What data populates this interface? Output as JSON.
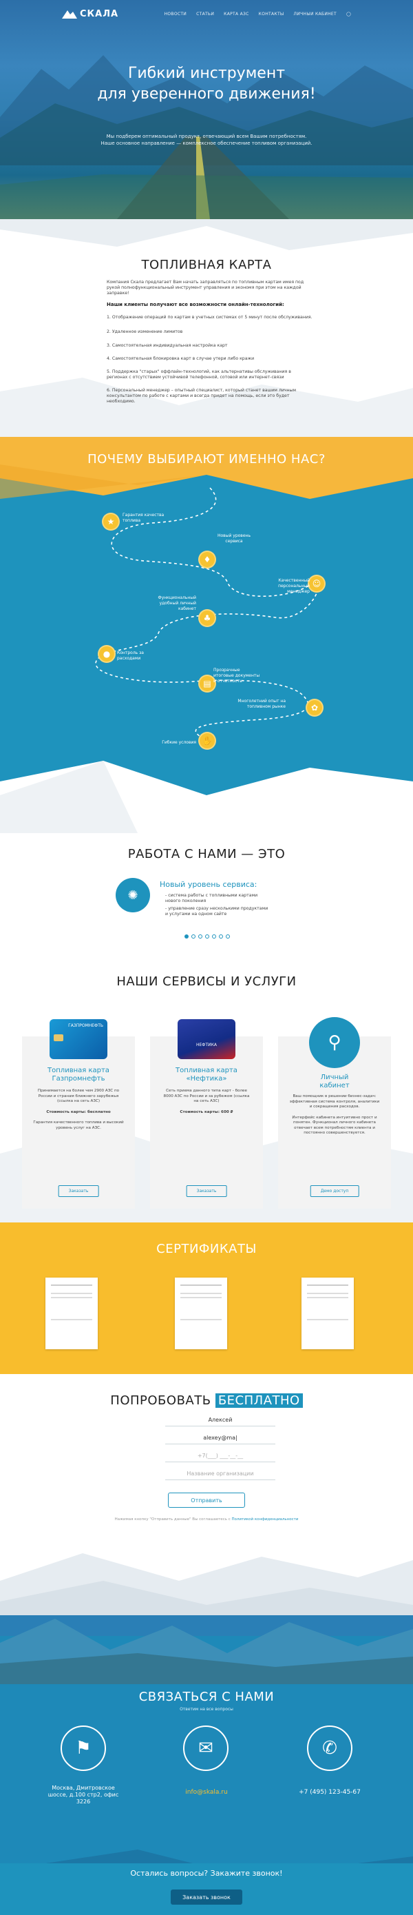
{
  "nav": {
    "logo": "СКАЛА",
    "items": [
      "НОВОСТИ",
      "СТАТЬИ",
      "КАРТА АЗС",
      "КОНТАКТЫ",
      "ЛИЧНЫЙ КАБИНЕТ"
    ]
  },
  "hero": {
    "title_1": "Гибкий инструмент",
    "title_2": "для уверенного движения!",
    "sub_1": "Мы подберем оптимальный продукт, отвечающий всем Вашим потребностям.",
    "sub_2": "Наше основное направление — комплексное обеспечение топливом организаций."
  },
  "fuel": {
    "title": "ТОПЛИВНАЯ КАРТА",
    "intro": "Компания Скала предлагает Вам начать заправляться по топливным картам имея под рукой полнофункциональный инструмент управления и экономя при этом на каждой заправке!",
    "subtitle": "Наши клиенты получают все возможности онлайн-технологий:",
    "items": [
      "1. Отображение операций по картам в учетных системах от 5 минут после обслуживания.",
      "2. Удаленное изменение лимитов",
      "3. Самостоятельная индивидуальная настройка карт",
      "4. Самостоятельная блокировка карт в случае утери либо кражи",
      "5. Поддержка \"старых\" оффлайн-технологий, как альтернативы обслуживания в регионах с отсутствием устойчивой телефонной, сотовой или интернет-связи",
      "6. Персональный менеджер – опытный специалист, который станет вашим личным консультантом по работе с картами и всегда придет на помощь, если это будет необходимо."
    ]
  },
  "why": {
    "title": "ПОЧЕМУ ВЫБИРАЮТ ИМЕННО НАС?",
    "steps": [
      "Гарантия качества топлива",
      "Новый уровень сервиса",
      "Качественный персональный менеджер",
      "Функциональный удобный личный кабинет",
      "Контроль за расходами",
      "Прозрачные итоговые документы и отчетность",
      "Многолетний опыт на топливном рынке",
      "Гибкие условия"
    ]
  },
  "work": {
    "title": "РАБОТА С НАМИ — ЭТО",
    "slide_title": "Новый уровень сервиса:",
    "slide_items": [
      "- система работы с топливными картами нового поколения",
      "- управление сразу несколькими продуктами и услугами на одном сайте"
    ]
  },
  "services": {
    "title": "НАШИ СЕРВИСЫ И УСЛУГИ",
    "cards": [
      {
        "title_1": "Топливная карта",
        "title_2": "Газпромнефть",
        "text": "Принимается на более чем 2900 АЗС по России и странам ближнего зарубежья (ссылка на сеть АЗС)",
        "price": "Стоимость карты: бесплатно",
        "extra": "Гарантия качественного топлива и высокий уровень услуг на АЗС.",
        "btn": "Заказать",
        "card_label": "ГАЗПРОМНЕФТЬ"
      },
      {
        "title_1": "Топливная карта",
        "title_2": "«Нефтика»",
        "text": "Сеть приема данного типа карт - более 8000 АЗС по России и за рубежом (ссылка на сеть АЗС)",
        "price": "Стоимость карты: 600 ₽",
        "extra": "",
        "btn": "Заказать",
        "card_label": "НЕФТИКА"
      },
      {
        "title_1": "Личный",
        "title_2": "кабинет",
        "text": "Ваш помощник в решении бизнес-задач: эффективная система контроля, аналитики и сокращения расходов.",
        "price": "",
        "extra": "Интерфейс кабинета интуитивно прост и понятен. Функционал личного кабинета отвечает всем потребностям клиента и постоянно совершенствуется.",
        "btn": "Демо доступ",
        "card_label": ""
      }
    ]
  },
  "cert": {
    "title": "СЕРТИФИКАТЫ"
  },
  "try": {
    "title_1": "ПОПРОБОВАТЬ",
    "title_2": "БЕСПЛАТНО",
    "name": "Алексей",
    "email": "alexey@ma|",
    "phone_ph": "+7(___) ___-__-__",
    "org_ph": "Название организации",
    "btn": "Отправить",
    "agree": "Нажимая кнопку \"Отправить данные\" Вы соглашаетесь с",
    "policy": "Политикой конфиденциальности"
  },
  "contact": {
    "title": "СВЯЗАТЬСЯ С НАМИ",
    "sub": "Ответим на все вопросы",
    "address": "Москва, Дмитровское шоссе, д.100 стр2, офис 3226",
    "email": "info@skala.ru",
    "phone": "+7 (495) 123-45-67",
    "question": "Остались вопросы? Закажите звонок!",
    "callback": "Заказать звонок"
  }
}
